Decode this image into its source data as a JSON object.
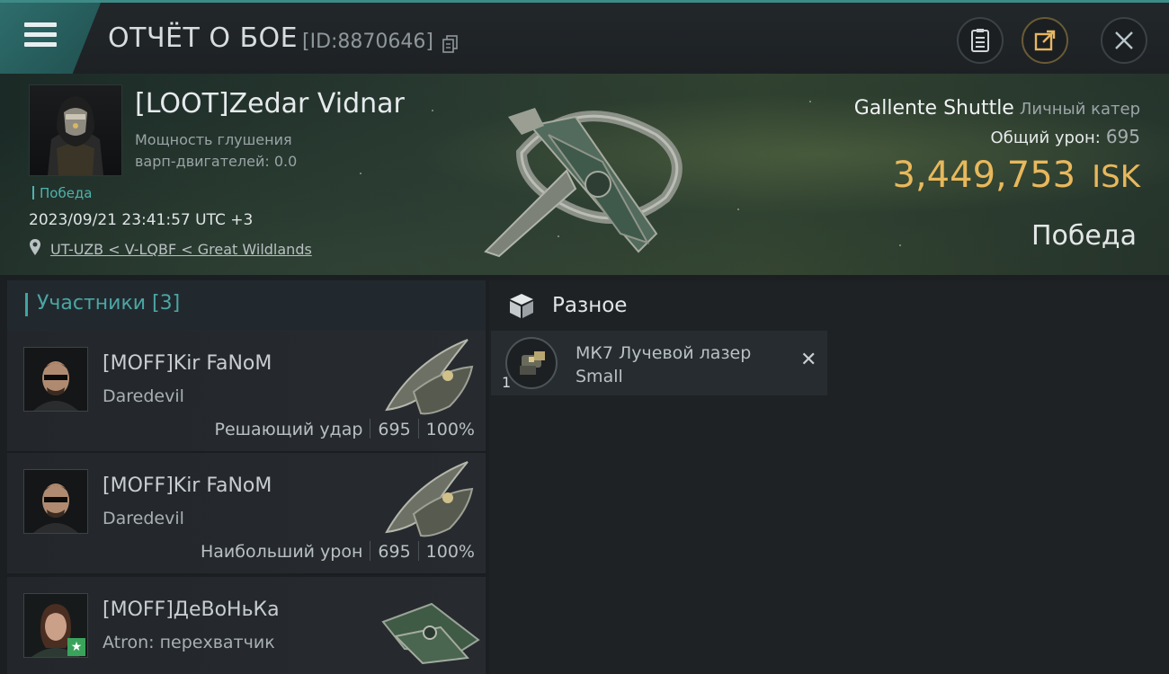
{
  "header": {
    "title": "ОТЧЁТ О БОЕ",
    "report_id": "[ID:8870646]"
  },
  "icons": {
    "menu": "menu-icon",
    "copy": "copy-icon",
    "clipboard": "clipboard-icon",
    "share": "share-icon",
    "close": "close-icon",
    "location": "location-pin-icon",
    "misc": "box-icon",
    "remove": "close-x-icon",
    "star": "star-icon"
  },
  "victim": {
    "name": "[LOOT]Zedar Vidnar",
    "warp_jam_line1": "Мощность глушения",
    "warp_jam_line2": "варп-двигателей: 0.0",
    "result_label": "Победа",
    "datetime": "2023/09/21 23:41:57 UTC +3",
    "location": "UT-UZB < V-LQBF < Great Wildlands",
    "ship_name": "Gallente Shuttle",
    "ship_class": "Личный катер",
    "total_damage_label": "Общий урон:",
    "total_damage": "695",
    "isk_value": "3,449,753",
    "isk_unit": "ISK",
    "result_big": "Победа"
  },
  "participants": {
    "title": "Участники [3]",
    "items": [
      {
        "name": "[MOFF]Kir FaNoM",
        "ship": "Daredevil",
        "role": "Решающий удар",
        "damage": "695",
        "percent": "100%"
      },
      {
        "name": "[MOFF]Kir FaNoM",
        "ship": "Daredevil",
        "role": "Наибольший урон",
        "damage": "695",
        "percent": "100%"
      },
      {
        "name": "[MOFF]ДеВоНьКа",
        "ship": "Atron: перехватчик"
      }
    ]
  },
  "misc": {
    "title": "Разное",
    "items": [
      {
        "name": "МК7 Лучевой лазер",
        "size": "Small",
        "qty": "1"
      }
    ]
  },
  "colors": {
    "accent_teal": "#3ea6a3",
    "isk_gold": "#e8b85c",
    "background": "#1c1f22"
  }
}
